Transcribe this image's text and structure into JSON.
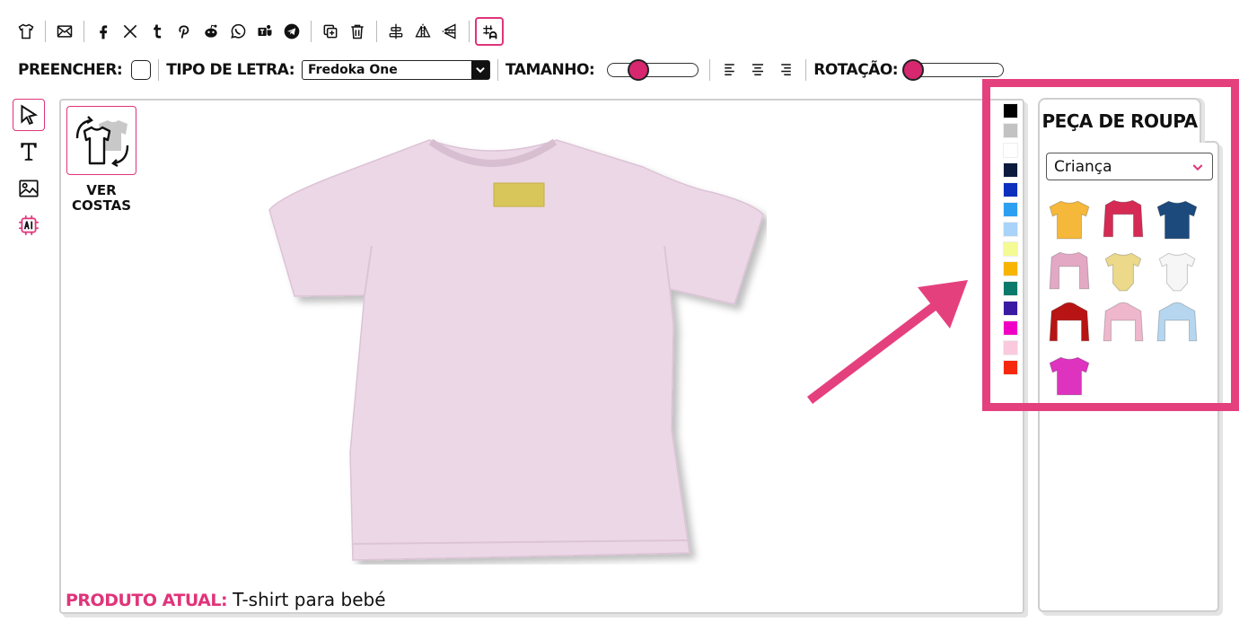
{
  "toolbar_icons": [
    "tshirt-icon",
    "mail-icon",
    "facebook-icon",
    "x-icon",
    "tumblr-icon",
    "pinterest-icon",
    "reddit-icon",
    "whatsapp-icon",
    "teams-icon",
    "telegram-icon",
    "copy-icon",
    "trash-icon",
    "align-center-vertical-icon",
    "flip-horizontal-icon",
    "flip-vertical-icon",
    "grid-snap-icon"
  ],
  "fill": {
    "label": "PREENCHER:"
  },
  "font": {
    "label": "TIPO DE LETRA:",
    "value": "Fredoka One"
  },
  "size": {
    "label": "TAMANHO:",
    "value_fraction": 0.3
  },
  "rotation": {
    "label": "ROTAÇÃO:",
    "value_fraction": 0.0
  },
  "left_tools": [
    "pointer-icon",
    "text-icon",
    "image-icon",
    "ai-icon"
  ],
  "view_back": {
    "label_line1": "VER",
    "label_line2": "COSTAS"
  },
  "product": {
    "label": "PRODUTO ATUAL:",
    "value": "T-shirt para bebé",
    "color": "#ecd7e7"
  },
  "colors": [
    "#000000",
    "#c2c2c2",
    "#ffffff",
    "#0b1a3d",
    "#0c2fbd",
    "#2c9ff0",
    "#a9d3f8",
    "#f4fb94",
    "#f7b400",
    "#0b7a6a",
    "#3a1aa3",
    "#f000c4",
    "#fac9dd",
    "#f5280f"
  ],
  "panel": {
    "tab_label": "PEÇA DE ROUPA",
    "category": "Criança",
    "items": [
      {
        "name": "yellow-tshirt",
        "color": "#f6b83a"
      },
      {
        "name": "varsity-jacket",
        "color": "#d42a54"
      },
      {
        "name": "navy-tshirt",
        "color": "#1c4a7c"
      },
      {
        "name": "pink-longsleeve",
        "color": "#e3a8c4"
      },
      {
        "name": "yellow-bodysuit",
        "color": "#ecd98a"
      },
      {
        "name": "white-bodysuit",
        "color": "#f6f6f6"
      },
      {
        "name": "red-hoodie",
        "color": "#b81414"
      },
      {
        "name": "pink-hoodie",
        "color": "#efb7cc"
      },
      {
        "name": "lightblue-hoodie",
        "color": "#b5d6ee"
      },
      {
        "name": "magenta-tshirt",
        "color": "#de33bf"
      }
    ]
  },
  "accent": "#e0347a"
}
